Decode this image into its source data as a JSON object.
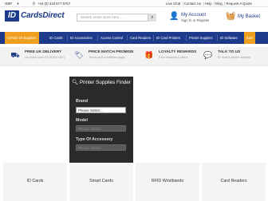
{
  "topbar": {
    "currency": "GBP",
    "phone": "+44 (0) 333 577 5767",
    "links": [
      "Live Chat",
      "Contact Us",
      "Help",
      "Blog",
      "Request A Quote"
    ]
  },
  "header": {
    "logo_id": "ID",
    "logo_text": "CardsDirect",
    "search_placeholder": "Search entire store here...",
    "account_title": "My Account",
    "account_sub": "Sign In or Register",
    "basket_title": "My Basket"
  },
  "nav": {
    "covid": "COVID-19 Supplies",
    "items": [
      "ID Cards",
      "ID Accessories",
      "Access Control",
      "Card Readers",
      "ID Card Printers",
      "Printer Supplies",
      "ID Software"
    ],
    "sale": "Sale"
  },
  "features": [
    {
      "icon": "truck-icon",
      "title": "FREE UK DELIVERY",
      "sub": "on orders over £125 (Ex.VAT)"
    },
    {
      "icon": "price-tag-icon",
      "title": "PRICE MATCH PROMISE",
      "sub": "Terms and conditions apply"
    },
    {
      "icon": "gift-icon",
      "title": "LOYALTY REWARDS",
      "sub": "Earn rewards & offers"
    },
    {
      "icon": "chat-icon",
      "title": "TALK TO US",
      "sub": "ID card & printer experts"
    }
  ],
  "finder": {
    "title": "Printer Supplies Finder",
    "brand_label": "Brand",
    "brand_value": "Please Select...",
    "model_label": "Model",
    "model_value": "Please Select...",
    "type_label": "Type Of Accessory",
    "type_value": "Please Select..."
  },
  "tiles": [
    "ID Cards",
    "Smart Cards",
    "RFID Wristbands",
    "Card Readers"
  ],
  "colors": {
    "brand": "#1e3a8a",
    "accent": "#f0a020",
    "finder_bg": "#2b2b2b"
  }
}
